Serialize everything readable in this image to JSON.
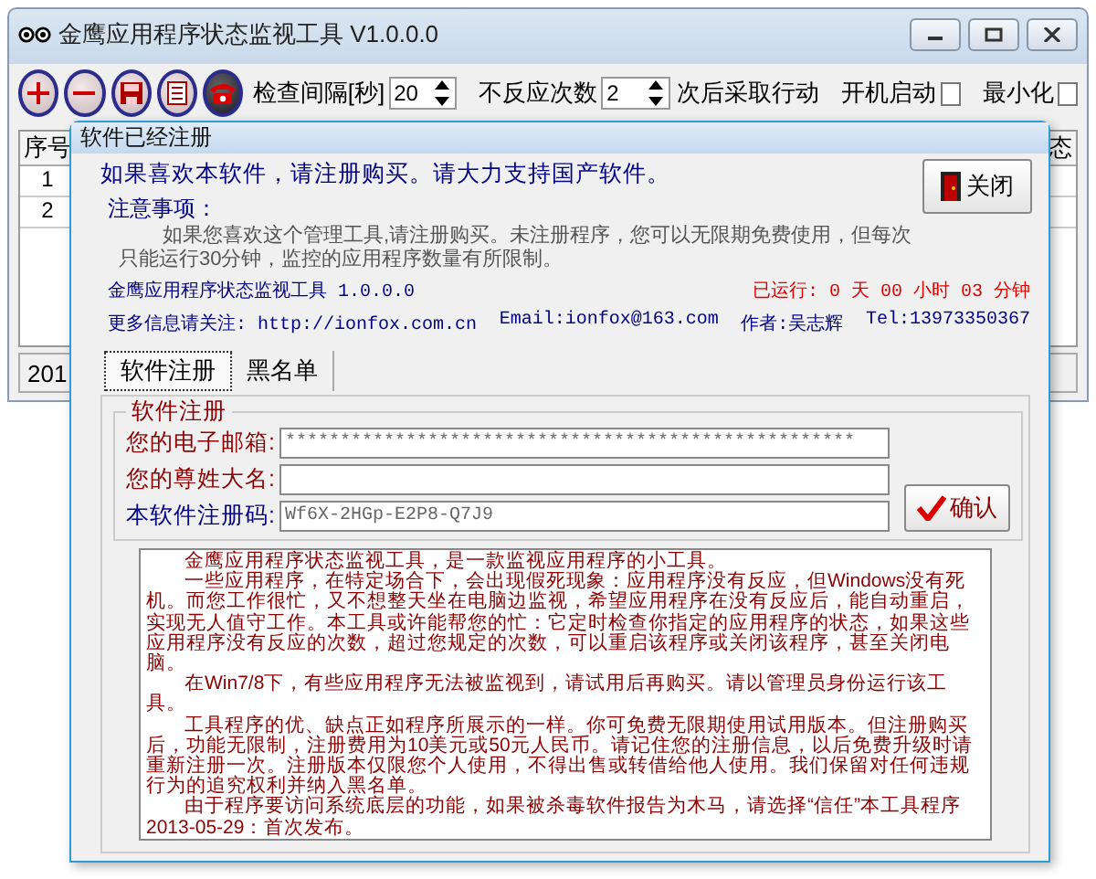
{
  "main_window": {
    "title": "金鹰应用程序状态监视工具 V1.0.0.0",
    "toolbar": {
      "interval_label": "检查间隔[秒]",
      "interval_value": "20",
      "retry_label": "不反应次数",
      "retry_value": "2",
      "action_label": "次后采取行动",
      "options": [
        {
          "label": "开机启动",
          "checked": false
        },
        {
          "label": "最小化",
          "checked": false
        }
      ]
    },
    "table": {
      "columns": [
        "序号",
        "态"
      ],
      "rows": [
        "1",
        "2"
      ]
    },
    "status_bar": "201"
  },
  "dialog": {
    "title": "软件已经注册",
    "intro": "如果喜欢本软件，请注册购买。请大力支持国产软件。",
    "close_button": "关闭",
    "notice_heading": "注意事项：",
    "notice_text": "如果您喜欢这个管理工具,请注册购买。未注册程序，您可以无限期免费使用，但每次只能运行30分钟，监控的应用程序数量有所限制。",
    "product": "金鹰应用程序状态监视工具 1.0.0.0",
    "runtime": "已运行: 0 天 00 小时 03 分钟",
    "more_info": "更多信息请关注: http://ionfox.com.cn",
    "email": "Email:ionfox@163.com",
    "author": "作者:吴志辉",
    "tel": "Tel:13973350367",
    "tabs": [
      {
        "label": "软件注册",
        "selected": true
      },
      {
        "label": "黑名单",
        "selected": false
      }
    ],
    "group_title": "软件注册",
    "fields": [
      {
        "label": "您的电子邮箱:",
        "value": "****************************************************",
        "color": "#8b0000"
      },
      {
        "label": "您的尊姓大名:",
        "color": "#8b0000"
      },
      {
        "label": "本软件注册码:",
        "value": "Wf6X-2HGp-E2P8-Q7J9",
        "color": "#000080"
      }
    ],
    "confirm_button": "确认",
    "description": [
      {
        "text": "金鹰应用程序状态监视工具，是一款监视应用程序的小工具。",
        "kind": "paragraph"
      },
      {
        "text": "一些应用程序，在特定场合下，会出现假死现象：应用程序没有反应，但Windows没有死机。而您工作很忙，又不想整天坐在电脑边监视，希望应用程序在没有反应后，能自动重启，实现无人值守工作。本工具或许能帮您的忙：它定时检查你指定的应用程序的状态，如果这些应用程序没有反应的次数，超过您规定的次数，可以重启该程序或关闭该程序，甚至关闭电脑。",
        "kind": "paragraph"
      },
      {
        "text": "在Win7/8下，有些应用程序无法被监视到，请试用后再购买。请以管理员身份运行该工具。",
        "kind": "paragraph"
      },
      {
        "text": "工具程序的优、缺点正如程序所展示的一样。你可免费无限期使用试用版本。但注册购买后，功能无限制，注册费用为10美元或50元人民币。请记住您的注册信息，以后免费升级时请重新注册一次。注册版本仅限您个人使用，不得出售或转借给他人使用。我们保留对任何违规行为的追究权利并纳入黑名单。",
        "kind": "paragraph"
      },
      {
        "text": "由于程序要访问系统底层的功能，如果被杀毒软件报告为木马，请选择“信任”本工具程序",
        "kind": "paragraph"
      },
      {
        "text": "2013-05-29：首次发布。",
        "kind": "release_note"
      }
    ]
  }
}
